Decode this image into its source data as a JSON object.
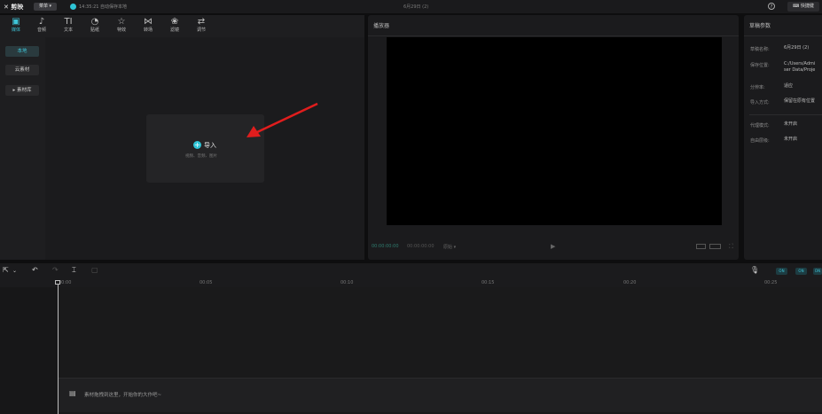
{
  "topbar": {
    "logo": "✕ 剪映",
    "menu_label": "菜单 ▾",
    "save_status": "14:35:21 自动保存本地",
    "doc_title": "6月29日 (2)",
    "help_icon": "help-icon",
    "shortcut_label": "⌨ 快捷键"
  },
  "media": {
    "tabs": [
      {
        "label": "媒体",
        "icon": "▣"
      },
      {
        "label": "音频",
        "icon": "♪"
      },
      {
        "label": "文本",
        "icon": "TI"
      },
      {
        "label": "贴纸",
        "icon": "◔"
      },
      {
        "label": "特效",
        "icon": "☆"
      },
      {
        "label": "转场",
        "icon": "⋈"
      },
      {
        "label": "滤镜",
        "icon": "❀"
      },
      {
        "label": "调节",
        "icon": "⇄"
      }
    ],
    "sidebar": [
      "本地",
      "云素材",
      "▸ 素材库"
    ],
    "import_label": "导入",
    "import_sub": "视频、音频、图片"
  },
  "player": {
    "title": "播放器",
    "time_current": "00:00:00:00",
    "time_total": "00:00:00:00",
    "ratio": "原始 ▾"
  },
  "params": {
    "title": "草稿参数",
    "rows": [
      {
        "label": "草稿名称:",
        "value": "6月29日 (2)"
      },
      {
        "label": "保存位置:",
        "value": "C:/Users/Admi"
      },
      {
        "label": "",
        "value": "ser Data/Proje"
      },
      {
        "label": "分辨率:",
        "value": "适应"
      },
      {
        "label": "导入方式:",
        "value": "保留在原有位置"
      },
      {
        "label": "代理模式:",
        "value": "未开启"
      },
      {
        "label": "自由层级:",
        "value": "未开启"
      }
    ]
  },
  "timeline": {
    "ticks": [
      "00:00",
      "00:05",
      "00:10",
      "00:15",
      "00:20",
      "00:25"
    ],
    "hint": "素材拖拽到这里，开始你的大作吧~",
    "buttons": [
      "ON",
      "ON",
      "ON"
    ]
  },
  "colors": {
    "accent": "#2ec4d6",
    "background": "#0e0e0f",
    "panel": "#1b1b1d"
  }
}
